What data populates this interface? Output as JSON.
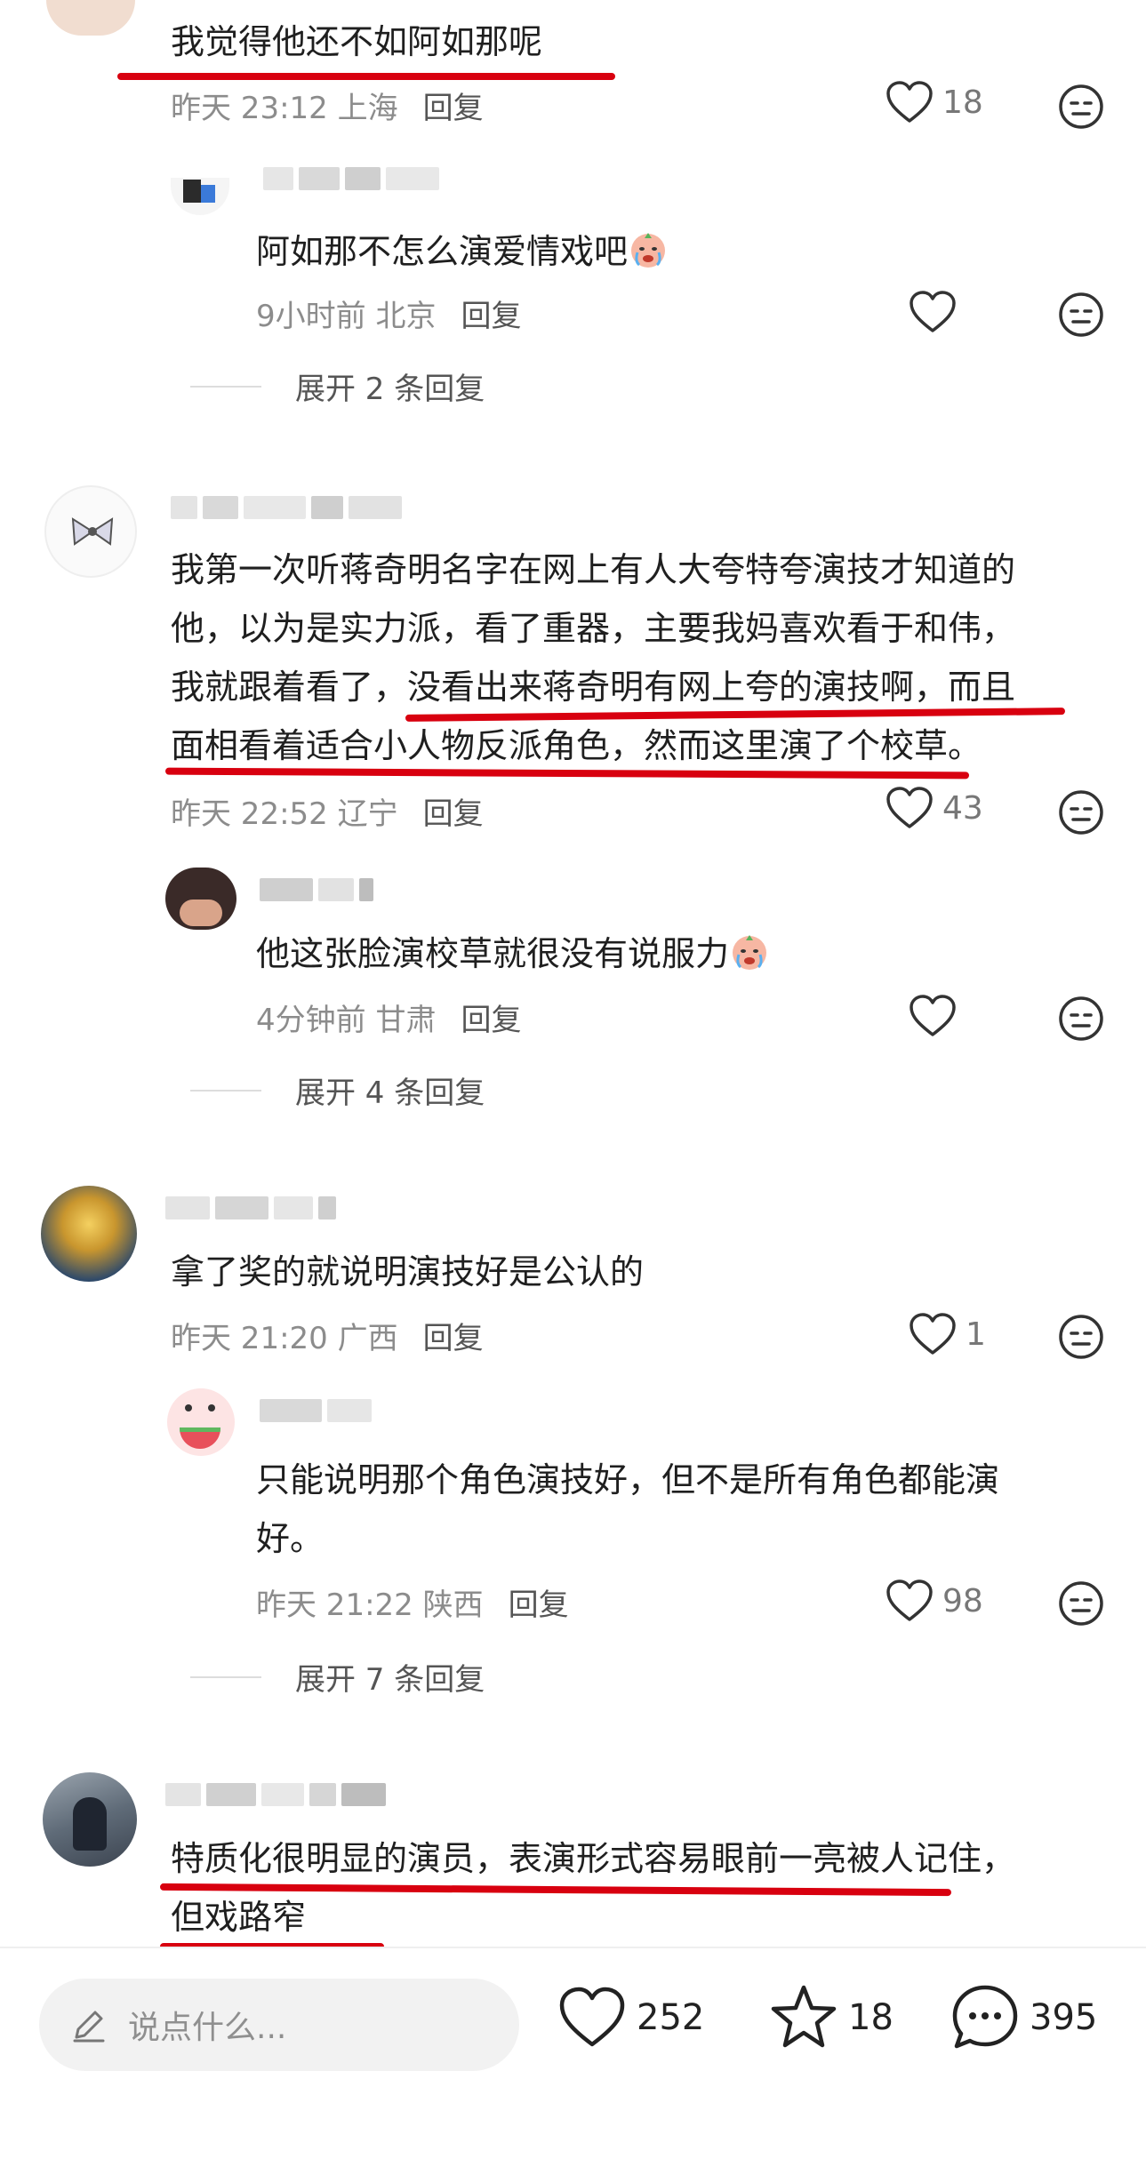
{
  "comments": [
    {
      "text": "我觉得他还不如阿如那呢",
      "time": "昨天 23:12 上海",
      "reply_label": "回复",
      "likes": "18",
      "replies": [
        {
          "text": "阿如那不怎么演爱情戏吧",
          "time": "9小时前 北京",
          "reply_label": "回复",
          "likes": ""
        }
      ],
      "expand_label": "展开 2 条回复"
    },
    {
      "text_lines": [
        "我第一次听蒋奇明名字在网上有人大夸特夸演技才知道的",
        "他，以为是实力派，看了重器，主要我妈喜欢看于和伟，",
        "我就跟着看了，没看出来蒋奇明有网上夸的演技啊，而且",
        "面相看着适合小人物反派角色，然而这里演了个校草。"
      ],
      "time": "昨天 22:52 辽宁",
      "reply_label": "回复",
      "likes": "43",
      "replies": [
        {
          "text": "他这张脸演校草就很没有说服力",
          "time": "4分钟前 甘肃",
          "reply_label": "回复",
          "likes": ""
        }
      ],
      "expand_label": "展开 4 条回复"
    },
    {
      "text": "拿了奖的就说明演技好是公认的",
      "time": "昨天 21:20 广西",
      "reply_label": "回复",
      "likes": "1",
      "replies": [
        {
          "text_lines": [
            "只能说明那个角色演技好，但不是所有角色都能演",
            "好。"
          ],
          "time": "昨天 21:22 陕西",
          "reply_label": "回复",
          "likes": "98"
        }
      ],
      "expand_label": "展开 7 条回复"
    },
    {
      "text_lines": [
        "特质化很明显的演员，表演形式容易眼前一亮被人记住，",
        "但戏路窄"
      ]
    }
  ],
  "bottom_bar": {
    "input_placeholder": "说点什么...",
    "likes": "252",
    "favorites": "18",
    "comments": "395"
  },
  "colors": {
    "annotation_red": "#d8000f",
    "meta_gray": "#8c8c8c",
    "input_bg": "#f2f2f2"
  }
}
